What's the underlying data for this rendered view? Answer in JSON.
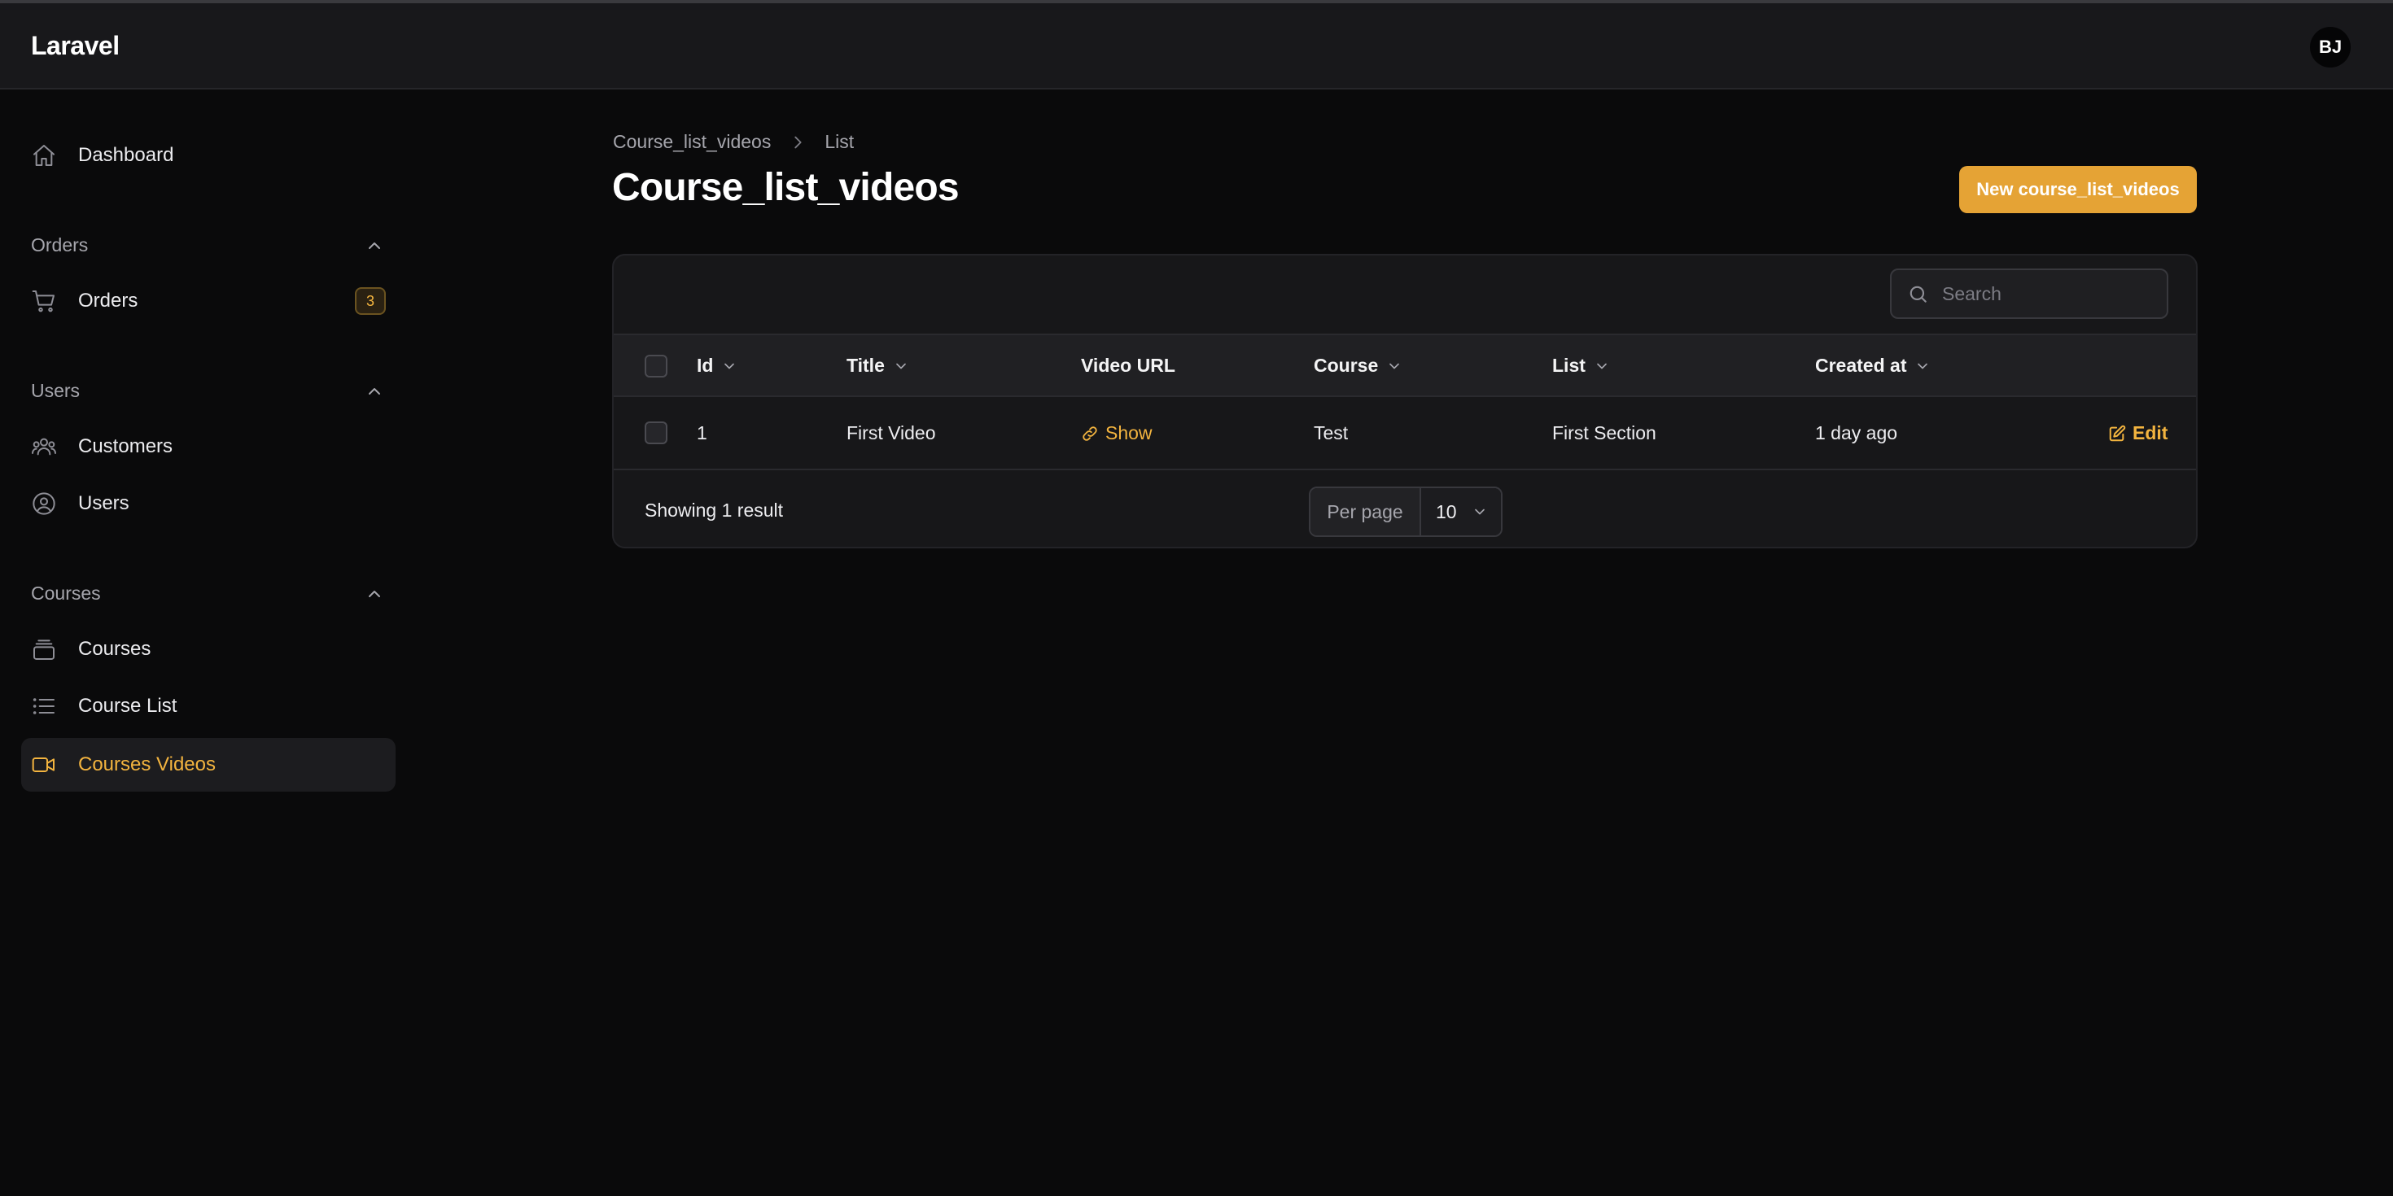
{
  "app": {
    "brand": "Laravel",
    "user_initials": "BJ"
  },
  "sidebar": {
    "dashboard": "Dashboard",
    "groups": {
      "orders": {
        "label": "Orders",
        "items": {
          "orders": {
            "label": "Orders",
            "badge": "3"
          }
        }
      },
      "users": {
        "label": "Users",
        "items": {
          "customers": "Customers",
          "users": "Users"
        }
      },
      "courses": {
        "label": "Courses",
        "items": {
          "courses": "Courses",
          "course_list": "Course List",
          "courses_videos": "Courses Videos"
        }
      }
    },
    "active_item": "Courses Videos"
  },
  "breadcrumb": [
    "Course_list_videos",
    "List"
  ],
  "page": {
    "title": "Course_list_videos",
    "new_button": "New course_list_videos"
  },
  "table": {
    "search_placeholder": "Search",
    "columns": [
      "Id",
      "Title",
      "Video URL",
      "Course",
      "List",
      "Created at"
    ],
    "rows": [
      {
        "id": "1",
        "title": "First Video",
        "video_url": "Show",
        "course": "Test",
        "list": "First Section",
        "created_at": "1 day ago",
        "action": "Edit"
      }
    ],
    "footer": {
      "showing": "Showing 1 result",
      "per_page_label": "Per page",
      "per_page_value": "10"
    }
  },
  "colors": {
    "accent": "#f3b43f",
    "button": "#e5a335",
    "background": "#0a0a0b",
    "panel": "#171719"
  }
}
